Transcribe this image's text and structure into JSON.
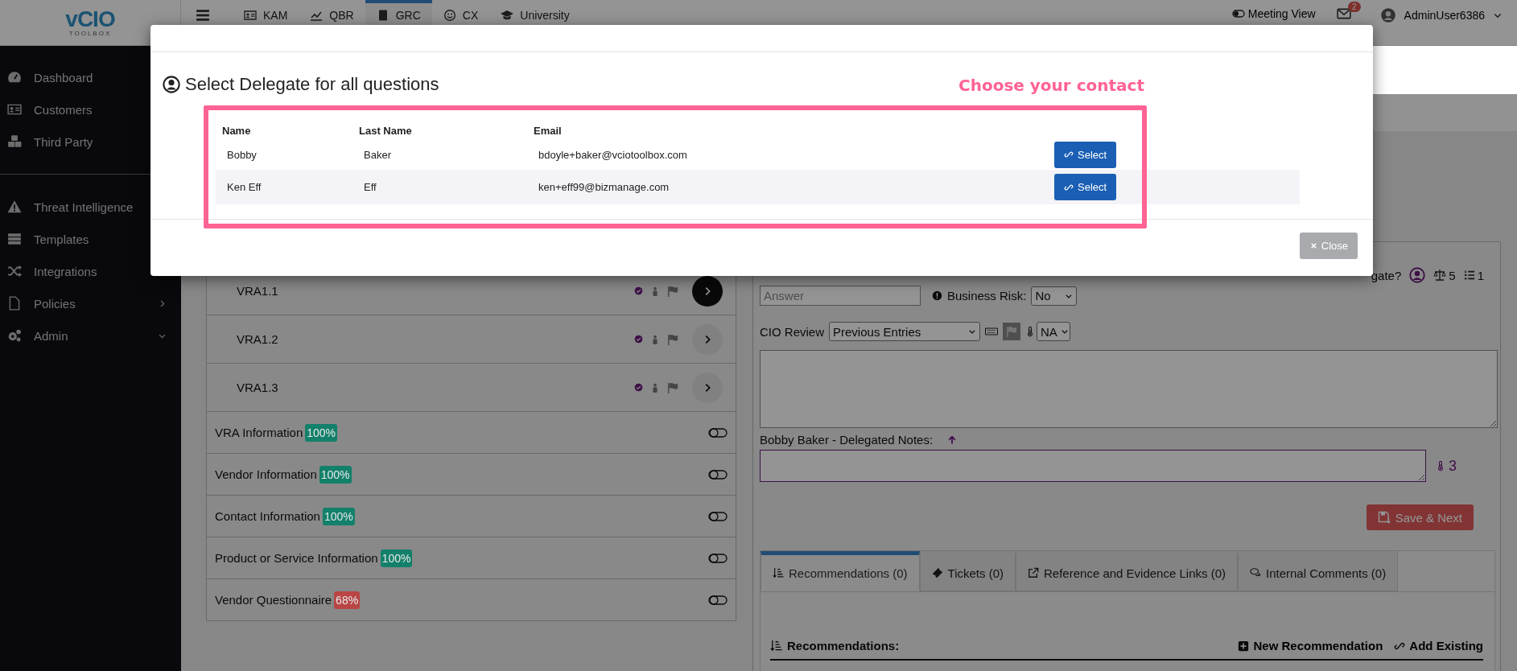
{
  "topbar": {
    "logo": {
      "name": "vCIO",
      "tagline": "TOOLBOX"
    },
    "nav": [
      {
        "label": "KAM",
        "selected": false
      },
      {
        "label": "QBR",
        "selected": false
      },
      {
        "label": "GRC",
        "selected": true
      },
      {
        "label": "CX",
        "selected": false
      },
      {
        "label": "University",
        "selected": false
      }
    ],
    "meeting_view": "Meeting View",
    "mail_count": "2",
    "user": "AdminUser6386"
  },
  "sidebar": {
    "groups": [
      [
        {
          "label": "Dashboard",
          "kind": "link"
        },
        {
          "label": "Customers",
          "kind": "link"
        },
        {
          "label": "Third Party",
          "kind": "link"
        }
      ],
      [
        {
          "label": "Threat Intelligence",
          "kind": "link"
        },
        {
          "label": "Templates",
          "kind": "link"
        },
        {
          "label": "Integrations",
          "kind": "link"
        },
        {
          "label": "Policies",
          "kind": "group",
          "expanded": false
        },
        {
          "label": "Admin",
          "kind": "group",
          "expanded": true
        }
      ]
    ]
  },
  "questions": [
    {
      "label": "VRA1.1",
      "selected": true
    },
    {
      "label": "VRA1.2",
      "selected": false
    },
    {
      "label": "VRA1.3",
      "selected": false
    }
  ],
  "sections": [
    {
      "label": "VRA Information",
      "badge": "100%",
      "color": "#12806a"
    },
    {
      "label": "Vendor Information",
      "badge": "100%",
      "color": "#12806a"
    },
    {
      "label": "Contact Information",
      "badge": "100%",
      "color": "#12806a"
    },
    {
      "label": "Product or Service Information",
      "badge": "100%",
      "color": "#12806a"
    },
    {
      "label": "Vendor Questionnaire",
      "badge": "68%",
      "color": "#b94545"
    }
  ],
  "question_panel": {
    "delegate_label": "gate?",
    "weight": "5",
    "count": "1",
    "answer": {
      "placeholder": "Answer"
    },
    "business_risk": {
      "label": "Business Risk:",
      "value": "No"
    },
    "cio_review": {
      "label": "CIO Review",
      "value": "Previous Entries",
      "rating": "NA"
    },
    "delegated_notes": {
      "label": "Bobby Baker - Delegated Notes:",
      "temperature": "3"
    },
    "save_button": "Save & Next"
  },
  "tabs": [
    {
      "label": "Recommendations (0)",
      "selected": true
    },
    {
      "label": "Tickets (0)",
      "selected": false
    },
    {
      "label": "Reference and Evidence Links (0)",
      "selected": false
    },
    {
      "label": "Internal Comments (0)",
      "selected": false
    }
  ],
  "recommendations": {
    "title": "Recommendations:",
    "new_button": "New Recommendation",
    "existing_button": "Add Existing"
  },
  "modal": {
    "title": "Select Delegate for all questions",
    "callout": "Choose your contact",
    "columns": [
      "Name",
      "Last Name",
      "Email"
    ],
    "rows": [
      {
        "name": "Bobby",
        "last_name": "Baker",
        "email": "bdoyle+baker@vciotoolbox.com",
        "action": "Select"
      },
      {
        "name": "Ken Eff",
        "last_name": "Eff",
        "email": "ken+eff99@bizmanage.com",
        "action": "Select"
      }
    ],
    "close_button": "Close"
  }
}
